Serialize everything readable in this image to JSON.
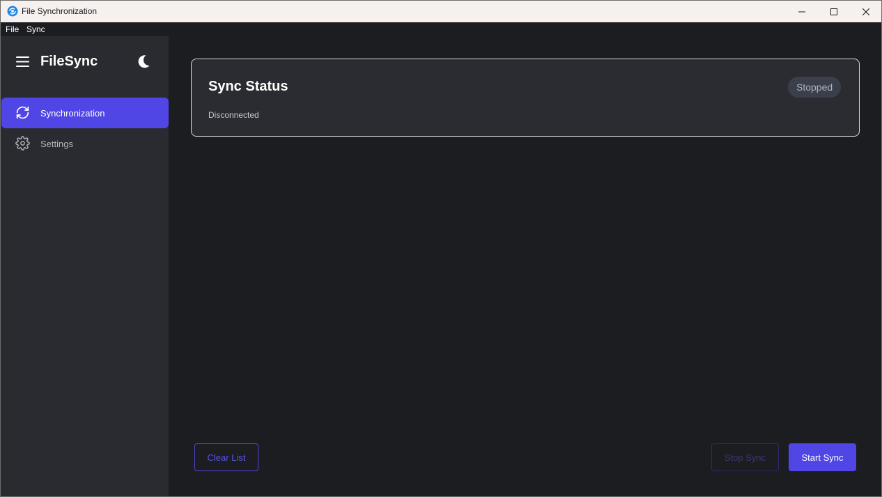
{
  "window": {
    "title": "File Synchronization"
  },
  "menu": {
    "file": "File",
    "sync": "Sync"
  },
  "sidebar": {
    "brand": "FileSync",
    "items": [
      {
        "label": "Synchronization",
        "icon": "sync-icon",
        "active": true
      },
      {
        "label": "Settings",
        "icon": "gear-icon",
        "active": false
      }
    ]
  },
  "status": {
    "title": "Sync Status",
    "connection": "Disconnected",
    "state": "Stopped"
  },
  "actions": {
    "clear_label": "Clear List",
    "stop_label": "Stop Sync",
    "start_label": "Start Sync"
  },
  "colors": {
    "accent": "#4f46e5",
    "background": "#1c1d21",
    "sidebar": "#2a2b30",
    "card": "#2b2c31"
  }
}
